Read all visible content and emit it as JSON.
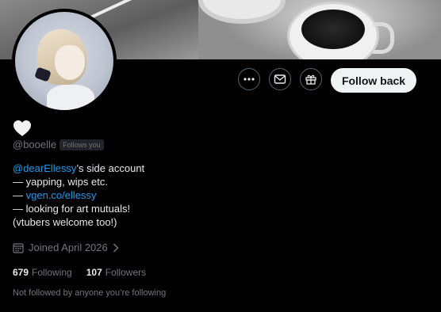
{
  "profile": {
    "display_name_icon": "heart-icon",
    "handle": "@booelle",
    "follows_you_badge": "Follows you",
    "follow_button_label": "Follow back",
    "bio": {
      "line1_mention": "@dearEllessy",
      "line1_rest": "’s side account",
      "line2": "— yapping, wips etc.",
      "line3_prefix": "— ",
      "line3_link": "vgen.co/ellessy",
      "line4": "— looking for art mutuals!",
      "line5": "(vtubers welcome too!)"
    },
    "joined": "Joined April 2026",
    "following_count": "679",
    "following_label": "Following",
    "followers_count": "107",
    "followers_label": "Followers",
    "not_followed_text": "Not followed by anyone you’re following"
  },
  "actions": {
    "more_icon": "more-icon",
    "message_icon": "envelope-icon",
    "gift_icon": "gift-icon"
  },
  "colors": {
    "background": "#000000",
    "link": "#1d9bf0",
    "muted": "#71767b",
    "text": "#e7e9ea",
    "follow_button_bg": "#eff3f4"
  }
}
